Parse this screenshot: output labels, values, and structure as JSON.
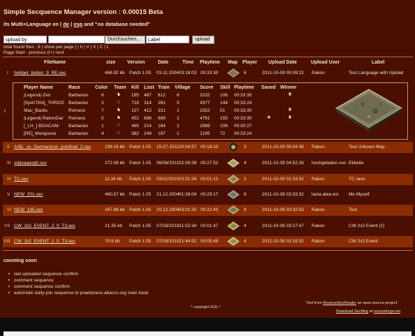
{
  "header": {
    "title": "Simple Secquence Manager version : 0.00015 Beta",
    "sub_prefix": "its Multi+Language en |",
    "lang_de": "de",
    "sub_mid": "|",
    "lang_esp": "esp",
    "sub_suffix": "and \"no database needed\""
  },
  "upload": {
    "by_value": "upload by",
    "file_value": "",
    "browse_label": "Durchsuchen...",
    "label_value": "Label",
    "upload_label": "upload"
  },
  "info": {
    "found": "total found files : 8 | show per page | | II | V | X | C | L",
    "pages": "Page Start : previous (I+) next"
  },
  "columns": {
    "filename": "FileName",
    "size": "size",
    "version": "Version",
    "date": "Date",
    "time": "Time",
    "playtime": "Playtime",
    "map": "Map",
    "player": "Player",
    "upload_date": "Upload Date",
    "upload_user": "Upload User",
    "label": "Label"
  },
  "rows": [
    {
      "nr": "I",
      "file": "heiliger_boden_9_RE.sec",
      "size": "468.92 kb",
      "version": "Patch 1.05",
      "date": "03.11.2004",
      "time": "03:18:03",
      "playtime": "00:33:30",
      "player": "6",
      "udate": "2011-10-09 05:08:22",
      "user": "Rakon",
      "label": "Test Language with Upload"
    },
    {
      "nr": "II",
      "file": "ArBL_vs_Germanicus_polufinal_2.sec",
      "size": "199.16 kb",
      "version": "Patch 1.05",
      "date": "15.07.2011",
      "time": "20:04:57",
      "playtime": "00:18:33",
      "player": "2",
      "udate": "2011-10-09 05:04:38",
      "user": "Rakon",
      "label": "Test Unkown Map"
    },
    {
      "nr": "III",
      "file": "sdgsagasgh.sec",
      "size": "272.08 kb",
      "version": "Patch 1.05",
      "date": "06/06/2011",
      "time": "02:06:39",
      "playtime": "00:27:52",
      "player": "4",
      "udate": "2011-10-09 04:52:26",
      "user": "hochgeladen von",
      "label": "Etikette"
    },
    {
      "nr": "IV",
      "file": "TC.sec",
      "size": "11.34 kb",
      "version": "Patch 1.05",
      "date": "03/11/2010",
      "time": "23:31:34",
      "playtime": "00:01:12",
      "player": "2",
      "udate": "2011-10-09 01:33:32",
      "user": "Rakon",
      "label": "TC race"
    },
    {
      "nr": "V",
      "file": "NEW_201.sec",
      "size": "460.57 kb",
      "version": "Patch 1.05",
      "date": "21.12.2004",
      "time": "01:39:04",
      "playtime": "00:29:17",
      "player": "8",
      "udate": "2011-10-08 03:33:32",
      "user": "lacta alea est",
      "label": "Me Myself"
    },
    {
      "nr": "VI",
      "file": "NEW_195.sec",
      "size": "347.88 kb",
      "version": "Patch 1.05",
      "date": "20.12.2004",
      "time": "23:01:25",
      "playtime": "00:22:43",
      "player": "8",
      "udate": "2011-10-08 03:32:53",
      "user": "Rakon",
      "label": "Test"
    },
    {
      "nr": "VII",
      "file": "CW_2v2_EVENT_2_0_T3.sec",
      "size": "21.35 kb",
      "version": "Patch 1.05",
      "date": "07/18/2010",
      "time": "21:52:34",
      "playtime": "00:01:47",
      "player": "4",
      "udate": "2011-10-08 03:27:47",
      "user": "Rakon",
      "label": "CW 2v2 Event (2)"
    },
    {
      "nr": "VIII",
      "file": "CW_2v2_EVENT_1_0_T3.sec",
      "size": "70.9 kb",
      "version": "Patch 1.05",
      "date": "07/18/2010",
      "time": "21:44:52",
      "playtime": "00:05:49",
      "player": "4",
      "udate": "2011-10-08 03:18:32",
      "user": "Rakon",
      "label": "CW 2v2 Event"
    }
  ],
  "detail": {
    "headers": {
      "player": "Player Name",
      "race": "Race",
      "color": "Color",
      "team": "Team",
      "kill": "Kill",
      "lost": "Lost",
      "train": "Train",
      "village": "Village",
      "score": "Score",
      "skill": "Skill",
      "playtime": "Playtime",
      "saved": "Saved",
      "winner": "Winner"
    },
    "players": [
      {
        "name": "|Legend|-Zen",
        "race": "Barbarian",
        "color": "6",
        "kill": "195",
        "lost": "467",
        "train": "612",
        "village": "6",
        "score": "3232",
        "skill": "106",
        "playtime": "00:33:30",
        "winner": true,
        "saved": false,
        "team": "team-a"
      },
      {
        "name": "[SpArTAN]_THRICE",
        "race": "Barbarian",
        "color": "2",
        "kill": "718",
        "lost": "314",
        "train": "261",
        "village": "5",
        "score": "4377",
        "skill": "144",
        "playtime": "00:33:24",
        "winner": false,
        "saved": false,
        "team": "team-b"
      },
      {
        "name": "Mau_Bastis",
        "race": "Romans",
        "color": "7",
        "kill": "127",
        "lost": "412",
        "train": "321",
        "village": "1",
        "score": "1552",
        "skill": "51",
        "playtime": "00:33:30",
        "winner": true,
        "saved": false,
        "team": "team-a"
      },
      {
        "name": "|Legend|-RakonDar",
        "race": "Romans",
        "color": "0",
        "kill": "451",
        "lost": "696",
        "train": "688",
        "village": "2",
        "score": "4761",
        "skill": "155",
        "playtime": "00:33:30",
        "winner": true,
        "saved": true,
        "team": "team-a"
      },
      {
        "name": "[_LH_]-BOACAM-",
        "race": "Barbarian",
        "color": "1",
        "kill": "465",
        "lost": "214",
        "train": "164",
        "village": "2",
        "score": "2989",
        "skill": "108",
        "playtime": "00:30:27",
        "winner": false,
        "saved": false,
        "team": "team-b"
      },
      {
        "name": "[RE]_Mongoose",
        "race": "Barbarian",
        "color": "4",
        "kill": "382",
        "lost": "249",
        "train": "197",
        "village": "1",
        "score": "2195",
        "skill": "72",
        "playtime": "00:33:24",
        "winner": false,
        "saved": false,
        "team": "team-b"
      }
    ]
  },
  "coming_soon": {
    "title": "cooming soon",
    "items": [
      "last uploaded sequence confirm",
      "comment sequence",
      "comment sequence confirm",
      "automatic daily-join sequence to praetorians.abacvs.org main base"
    ]
  },
  "footer": {
    "tool_prefix": "Tool from",
    "tool_link": "ReverseSecReader",
    "tool_suffix": "an open-source-project",
    "download_link": "Download SecMng",
    "at": "at",
    "sf_link": "sourceforge.net",
    "copyright": "* copyright 2011 *"
  },
  "colors": {
    "background": "#4a0f00",
    "row_alt": "#8a2c00",
    "border": "#c89868"
  }
}
